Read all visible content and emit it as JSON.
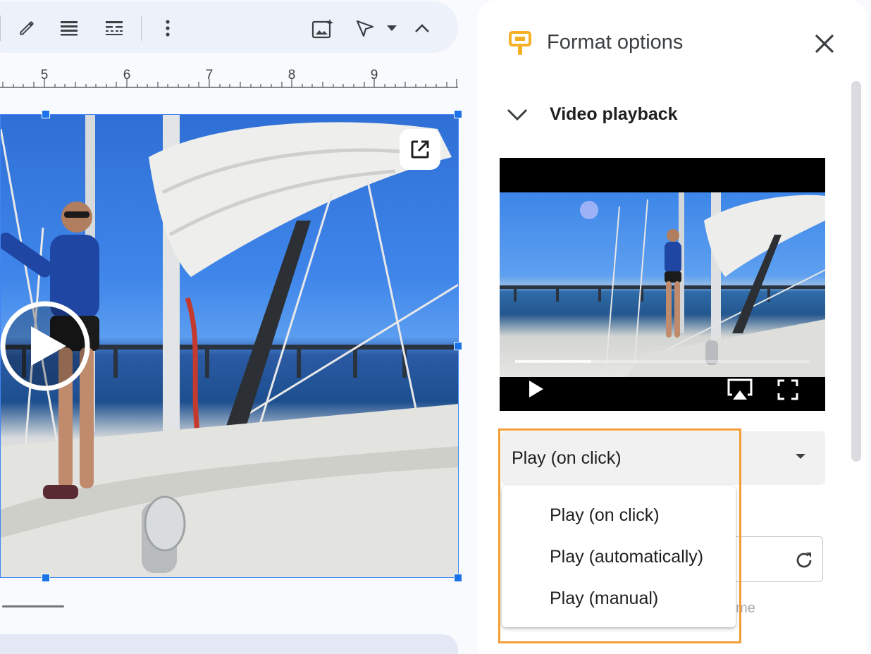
{
  "toolbar": {
    "icons": [
      "pencil-icon",
      "line-weight-icon",
      "line-dash-icon",
      "more-vert-icon",
      "image-insert-icon",
      "select-cursor-icon",
      "caret-down-icon",
      "chevron-up-icon"
    ]
  },
  "ruler": {
    "numbers": [
      "5",
      "6",
      "7",
      "8",
      "9"
    ]
  },
  "panel": {
    "title": "Format options",
    "section_title": "Video playback",
    "dropdown_value": "Play (on click)",
    "menu_options": [
      "Play (on click)",
      "Play (automatically)",
      "Play (manual)"
    ],
    "hint_fragment": "t time"
  },
  "colors": {
    "selection_blue": "#1a73e8",
    "highlight_orange": "#f29d38",
    "panel_icon_yellow": "#f6b026"
  }
}
